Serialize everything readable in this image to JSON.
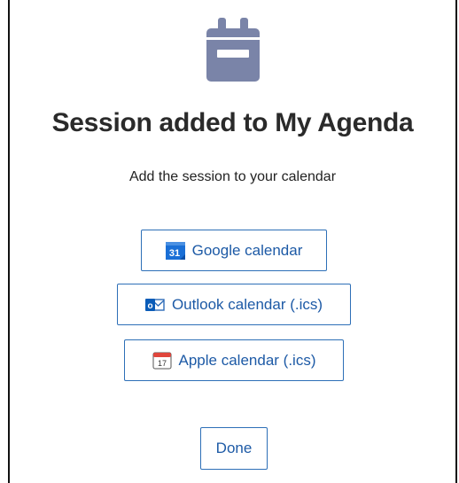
{
  "dialog": {
    "header_icon": "calendar-icon",
    "title": "Session added to My Agenda",
    "subtitle": "Add the session to your calendar",
    "buttons": [
      {
        "label": "Google calendar",
        "icon": "google-calendar-icon",
        "icon_text": "31"
      },
      {
        "label": "Outlook calendar (.ics)",
        "icon": "outlook-icon",
        "icon_text": "o"
      },
      {
        "label": "Apple calendar (.ics)",
        "icon": "apple-calendar-icon",
        "icon_text": "17"
      }
    ],
    "done_label": "Done"
  },
  "colors": {
    "accent": "#1d5aa6",
    "header_icon": "#7a84a8",
    "title_text": "#2a2a2a"
  }
}
